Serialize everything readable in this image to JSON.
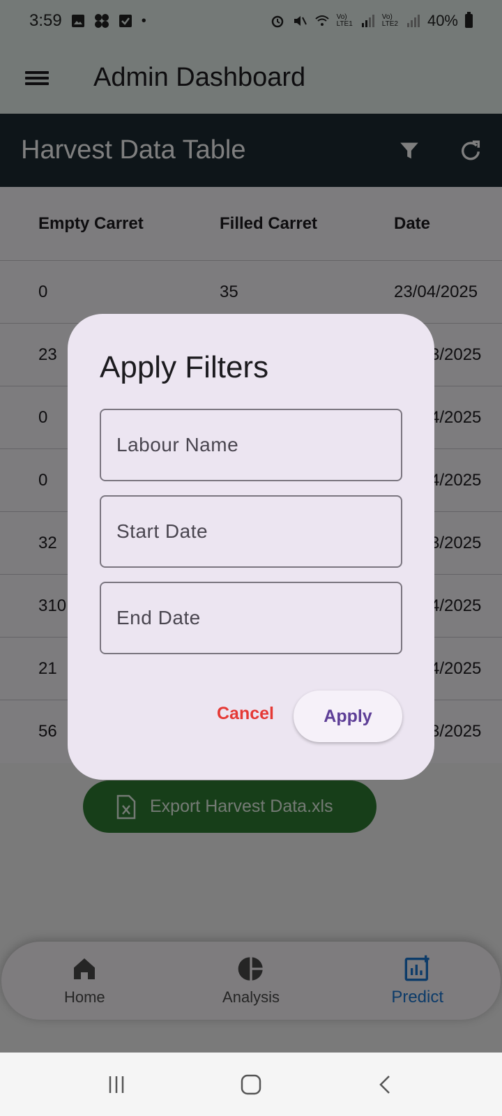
{
  "status_bar": {
    "time": "3:59",
    "right_labels": [
      "Vo)",
      "LTE1",
      "Vo)",
      "LTE2"
    ],
    "battery": "40%"
  },
  "app_bar": {
    "title": "Admin Dashboard"
  },
  "table_bar": {
    "title": "Harvest Data Table"
  },
  "table": {
    "headers": [
      "Empty Carret",
      "Filled Carret",
      "Date"
    ],
    "rows": [
      [
        "0",
        "35",
        "23/04/2025"
      ],
      [
        "23",
        "",
        "3/2025"
      ],
      [
        "0",
        "",
        "4/2025"
      ],
      [
        "0",
        "",
        "4/2025"
      ],
      [
        "32",
        "",
        "3/2025"
      ],
      [
        "310",
        "",
        "4/2025"
      ],
      [
        "21",
        "",
        "4/2025"
      ],
      [
        "56",
        "",
        "3/2025"
      ]
    ]
  },
  "export": {
    "label": "Export Harvest Data.xls"
  },
  "bottom_nav": {
    "items": [
      {
        "label": "Home",
        "icon": "home-icon"
      },
      {
        "label": "Analysis",
        "icon": "pie-chart-icon"
      },
      {
        "label": "Predict",
        "icon": "analytics-icon"
      }
    ]
  },
  "dialog": {
    "title": "Apply Filters",
    "fields": [
      {
        "placeholder": "Labour Name"
      },
      {
        "placeholder": "Start Date"
      },
      {
        "placeholder": "End Date"
      }
    ],
    "cancel_label": "Cancel",
    "apply_label": "Apply"
  },
  "colors": {
    "app_bar": "#e8f3ee",
    "table_bar": "#1d2a33",
    "export": "#2e7d32",
    "nav_active": "#1976d2",
    "cancel": "#e53935",
    "apply": "#5e3f97"
  }
}
